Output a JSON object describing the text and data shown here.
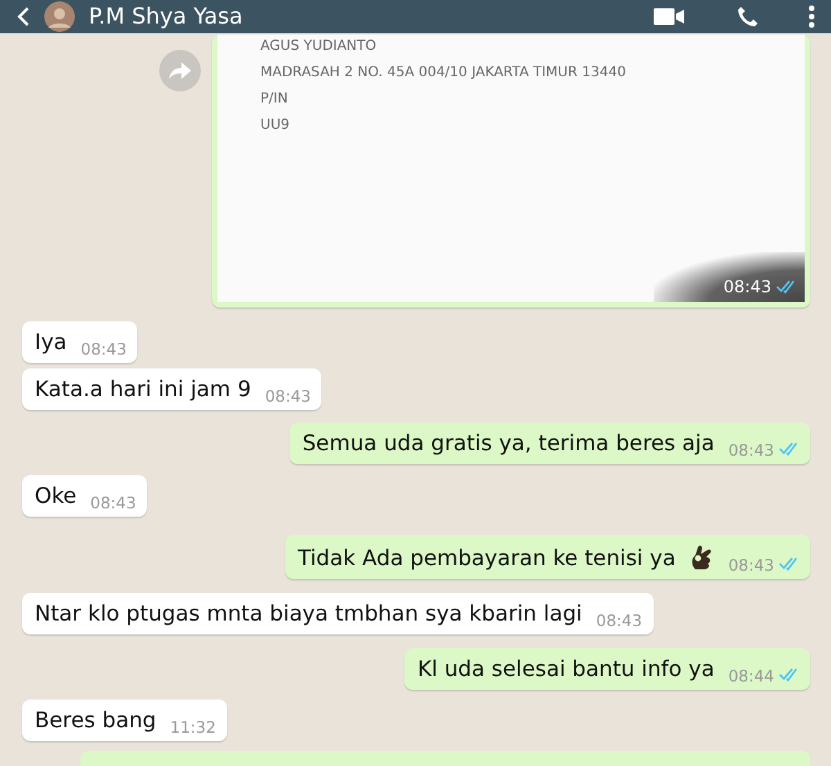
{
  "header": {
    "title": "P.M Shya Yasa"
  },
  "messages": [
    {
      "outgoing": true,
      "lines": [
        "AGUS YUDIANTO",
        "MADRASAH 2 NO. 45A 004/10  JAKARTA TIMUR 13440",
        "P/IN",
        "UU9"
      ],
      "time": "08:43",
      "read": true,
      "forward": true
    },
    {
      "kind": "text",
      "outgoing": false,
      "text": "Iya",
      "time": "08:43",
      "read": false
    },
    {
      "kind": "text",
      "outgoing": false,
      "text": "Kata.a hari ini jam 9",
      "time": "08:43",
      "read": false
    },
    {
      "kind": "text",
      "outgoing": true,
      "text": "Semua uda gratis ya, terima beres aja",
      "time": "08:43",
      "read": true
    },
    {
      "kind": "text",
      "outgoing": false,
      "text": "Oke",
      "time": "08:43",
      "read": false
    },
    {
      "kind": "text",
      "outgoing": true,
      "text": "Tidak Ada pembayaran ke tenisi ya",
      "ok_hand_emoji": true,
      "time": "08:43",
      "read": true
    },
    {
      "kind": "text",
      "outgoing": false,
      "text": "Ntar klo ptugas mnta biaya tmbhan sya kbarin lagi",
      "time": "08:43",
      "read": false
    },
    {
      "kind": "text",
      "outgoing": true,
      "text": "Kl uda selesai bantu info ya",
      "time": "08:44",
      "read": true
    },
    {
      "kind": "text",
      "outgoing": false,
      "text": "Beres bang",
      "time": "11:32",
      "read": false
    },
    {
      "kind": "peek",
      "outgoing": true
    }
  ]
}
